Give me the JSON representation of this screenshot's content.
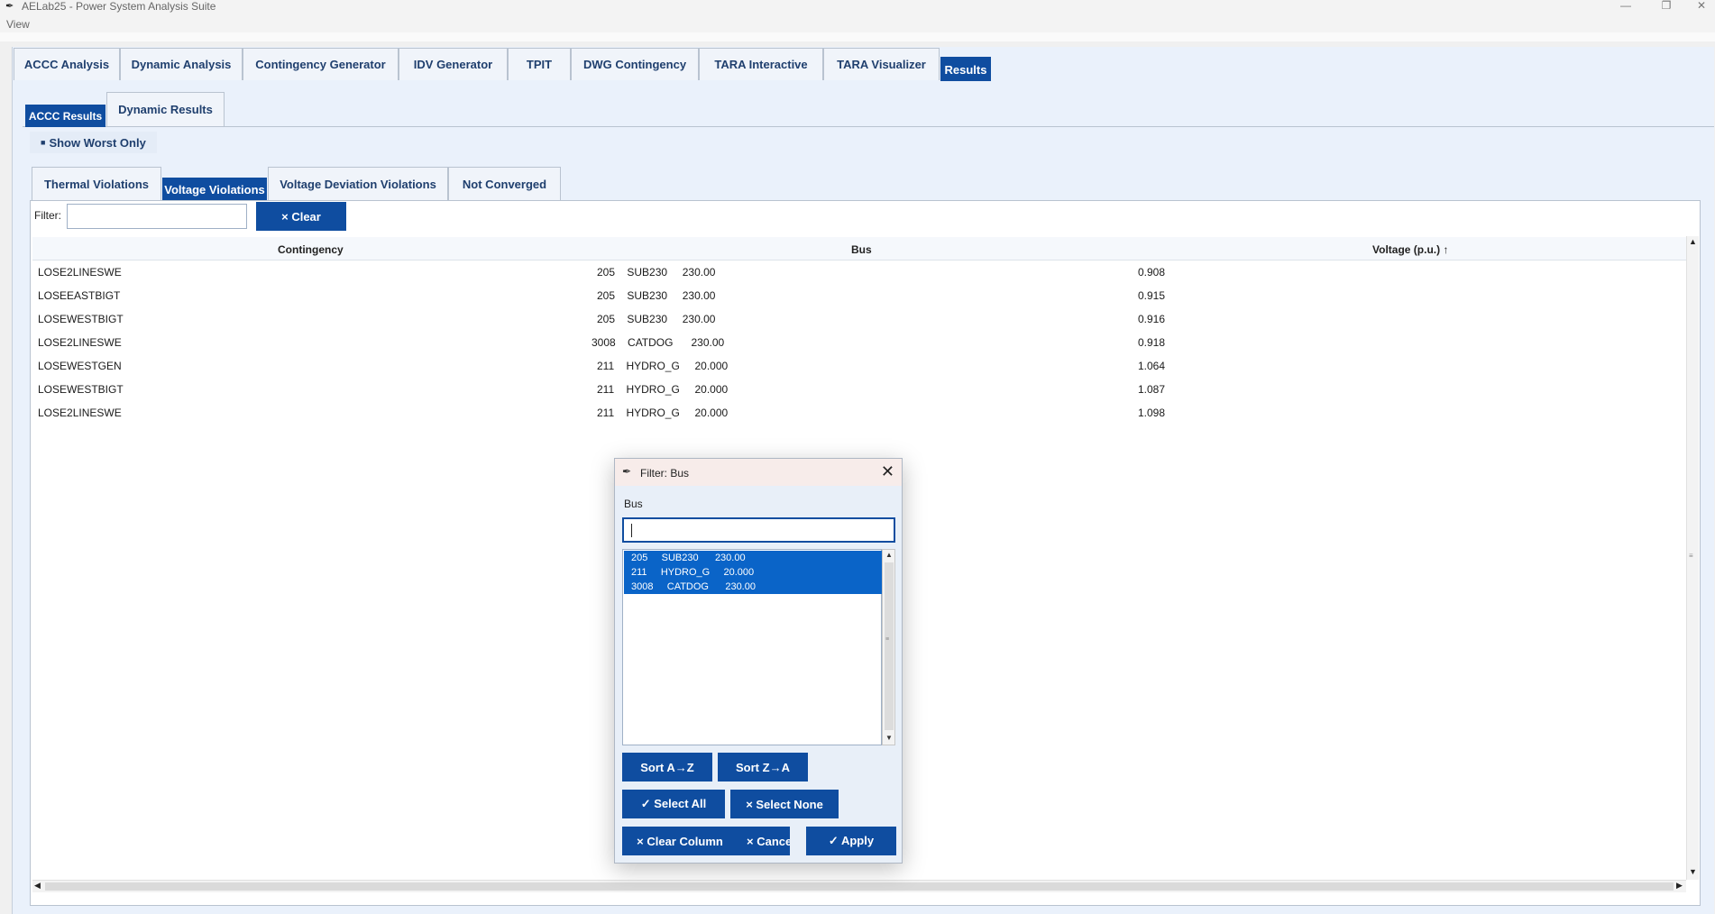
{
  "window": {
    "title": "AELab25 - Power System Analysis Suite",
    "minimize": "—",
    "restore": "❐",
    "close": "✕"
  },
  "menu": {
    "items": [
      "View"
    ]
  },
  "main_tabs": [
    "ACCC Analysis",
    "Dynamic Analysis",
    "Contingency Generator",
    "IDV Generator",
    "TPIT",
    "DWG Contingency",
    "TARA Interactive",
    "TARA Visualizer",
    "Results"
  ],
  "main_tabs_active": "Results",
  "results_tabs": [
    "ACCC Results",
    "Dynamic Results"
  ],
  "results_tabs_active": "ACCC Results",
  "toggle": {
    "label": "Show Worst Only",
    "icon": "square-icon"
  },
  "violation_tabs": [
    "Thermal Violations",
    "Voltage Violations",
    "Voltage Deviation Violations",
    "Not Converged"
  ],
  "violation_tabs_active": "Voltage Violations",
  "filter": {
    "label": "Filter:",
    "value": "",
    "clear_label": "× Clear"
  },
  "table": {
    "columns": [
      "Contingency",
      "Bus",
      "Voltage (p.u.) ↑"
    ],
    "rows": [
      {
        "contingency": "LOSE2LINESWE",
        "bus": "205    SUB230     230.00",
        "voltage": "0.908"
      },
      {
        "contingency": "LOSEEASTBIGT",
        "bus": "205    SUB230     230.00",
        "voltage": "0.915"
      },
      {
        "contingency": "LOSEWESTBIGT",
        "bus": "205    SUB230     230.00",
        "voltage": "0.916"
      },
      {
        "contingency": "LOSE2LINESWE",
        "bus": "3008    CATDOG      230.00",
        "voltage": "0.918"
      },
      {
        "contingency": "LOSEWESTGEN",
        "bus": "211    HYDRO_G     20.000",
        "voltage": "1.064"
      },
      {
        "contingency": "LOSEWESTBIGT",
        "bus": "211    HYDRO_G     20.000",
        "voltage": "1.087"
      },
      {
        "contingency": "LOSE2LINESWE",
        "bus": "211    HYDRO_G     20.000",
        "voltage": "1.098"
      }
    ]
  },
  "dialog": {
    "title": "Filter: Bus",
    "field_label": "Bus",
    "search_value": "",
    "list_items": [
      "205     SUB230      230.00",
      "211     HYDRO_G     20.000",
      "3008     CATDOG      230.00"
    ],
    "buttons": {
      "sort_az": "Sort A→Z",
      "sort_za": "Sort Z→A",
      "select_all": "✓ Select All",
      "select_none": "× Select None",
      "clear_column": "× Clear Column",
      "cancel": "× Cance",
      "apply": "✓ Apply"
    }
  },
  "colors": {
    "accent": "#0f4da0",
    "selection": "#0a64c8",
    "panel_bg": "#eaf1fb"
  }
}
